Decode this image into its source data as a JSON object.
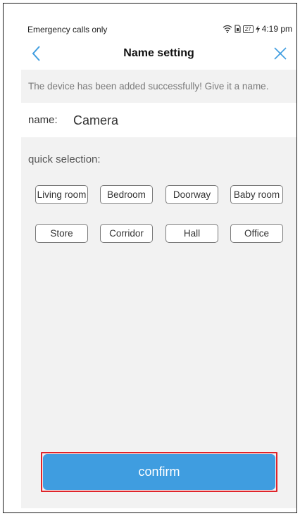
{
  "status_bar": {
    "carrier_text": "Emergency calls only",
    "battery": "27",
    "time": "4:19 pm"
  },
  "nav": {
    "title": "Name setting",
    "back_icon": "chevron-left-icon",
    "close_icon": "close-icon"
  },
  "notice": "The device has been added successfully! Give it a name.",
  "name_field": {
    "label": "name:",
    "value": "Camera"
  },
  "quick_selection": {
    "label": "quick selection:",
    "options": [
      "Living room",
      "Bedroom",
      "Doorway",
      "Baby room",
      "Store",
      "Corridor",
      "Hall",
      "Office"
    ]
  },
  "confirm": {
    "label": "confirm",
    "highlighted": true
  },
  "colors": {
    "accent": "#3f9de0",
    "highlight": "#e0242a",
    "background": "#f2f2f2"
  }
}
